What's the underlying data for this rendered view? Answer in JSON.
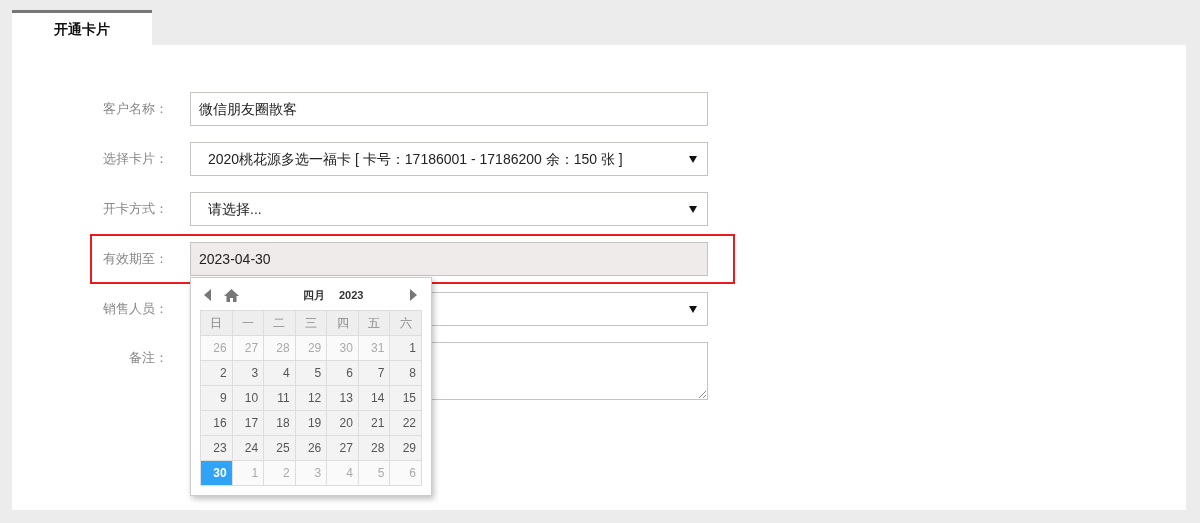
{
  "tabs": [
    {
      "label": "开通卡片",
      "selected": true
    }
  ],
  "fields": [
    {
      "kind": "text",
      "label": "客户名称：",
      "value": "微信朋友圈散客",
      "highlighted": false
    },
    {
      "kind": "select",
      "label": "选择卡片：",
      "value": "2020桃花源多选一福卡 [ 卡号：17186001 - 17186200 余：150 张 ]",
      "highlighted": false
    },
    {
      "kind": "select",
      "label": "开卡方式：",
      "value": "请选择...",
      "highlighted": false
    },
    {
      "kind": "date",
      "label": "有效期至：",
      "value": "2023-04-30",
      "highlighted": true
    },
    {
      "kind": "select",
      "label": "销售人员：",
      "highlighted": false
    },
    {
      "kind": "textarea",
      "label": "备注：",
      "highlighted": false
    }
  ],
  "calendar": {
    "month": "四月",
    "year": "2023",
    "weekdays": [
      "日",
      "一",
      "二",
      "三",
      "四",
      "五",
      "六"
    ],
    "days": [
      {
        "day": "26",
        "outside": true,
        "selected": false
      },
      {
        "day": "27",
        "outside": true,
        "selected": false
      },
      {
        "day": "28",
        "outside": true,
        "selected": false
      },
      {
        "day": "29",
        "outside": true,
        "selected": false
      },
      {
        "day": "30",
        "outside": true,
        "selected": false
      },
      {
        "day": "31",
        "outside": true,
        "selected": false
      },
      {
        "day": "1",
        "outside": false,
        "selected": false
      },
      {
        "day": "2",
        "outside": false,
        "selected": false
      },
      {
        "day": "3",
        "outside": false,
        "selected": false
      },
      {
        "day": "4",
        "outside": false,
        "selected": false
      },
      {
        "day": "5",
        "outside": false,
        "selected": false
      },
      {
        "day": "6",
        "outside": false,
        "selected": false
      },
      {
        "day": "7",
        "outside": false,
        "selected": false
      },
      {
        "day": "8",
        "outside": false,
        "selected": false
      },
      {
        "day": "9",
        "outside": false,
        "selected": false
      },
      {
        "day": "10",
        "outside": false,
        "selected": false
      },
      {
        "day": "11",
        "outside": false,
        "selected": false
      },
      {
        "day": "12",
        "outside": false,
        "selected": false
      },
      {
        "day": "13",
        "outside": false,
        "selected": false
      },
      {
        "day": "14",
        "outside": false,
        "selected": false
      },
      {
        "day": "15",
        "outside": false,
        "selected": false
      },
      {
        "day": "16",
        "outside": false,
        "selected": false
      },
      {
        "day": "17",
        "outside": false,
        "selected": false
      },
      {
        "day": "18",
        "outside": false,
        "selected": false
      },
      {
        "day": "19",
        "outside": false,
        "selected": false
      },
      {
        "day": "20",
        "outside": false,
        "selected": false
      },
      {
        "day": "21",
        "outside": false,
        "selected": false
      },
      {
        "day": "22",
        "outside": false,
        "selected": false
      },
      {
        "day": "23",
        "outside": false,
        "selected": false
      },
      {
        "day": "24",
        "outside": false,
        "selected": false
      },
      {
        "day": "25",
        "outside": false,
        "selected": false
      },
      {
        "day": "26",
        "outside": false,
        "selected": false
      },
      {
        "day": "27",
        "outside": false,
        "selected": false
      },
      {
        "day": "28",
        "outside": false,
        "selected": false
      },
      {
        "day": "29",
        "outside": false,
        "selected": false
      },
      {
        "day": "30",
        "outside": false,
        "selected": true
      },
      {
        "day": "1",
        "outside": true,
        "selected": false
      },
      {
        "day": "2",
        "outside": true,
        "selected": false
      },
      {
        "day": "3",
        "outside": true,
        "selected": false
      },
      {
        "day": "4",
        "outside": true,
        "selected": false
      },
      {
        "day": "5",
        "outside": true,
        "selected": false
      },
      {
        "day": "6",
        "outside": true,
        "selected": false
      }
    ]
  }
}
